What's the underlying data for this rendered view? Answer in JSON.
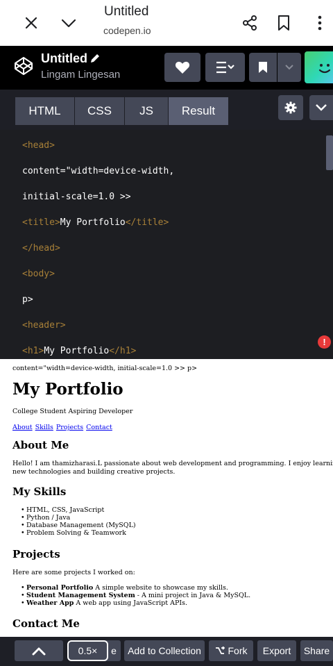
{
  "browser": {
    "title": "Untitled",
    "url": "codepen.io"
  },
  "codepen": {
    "title": "Untitled",
    "author": "Lingam Lingesan"
  },
  "editor": {
    "tabs": [
      {
        "label": "HTML"
      },
      {
        "label": "CSS"
      },
      {
        "label": "JS"
      },
      {
        "label": "Result"
      }
    ],
    "code_lines": [
      {
        "tag": "<head>"
      },
      {
        "text": "content=\"width=device-width,"
      },
      {
        "text": "initial-scale=1.0 >>"
      },
      {
        "open": "<title>",
        "text": "My Portfolio",
        "close": "</title>"
      },
      {
        "tag": "</head>"
      },
      {
        "tag": "<body>"
      },
      {
        "text": "p>"
      },
      {
        "tag": "<header>"
      },
      {
        "open": "<h1>",
        "text": "My Portfolio",
        "close": "</h1>"
      }
    ],
    "error_badge": "!"
  },
  "result": {
    "meta_line": "content=\"width=device-width, initial-scale=1.0 >> p>",
    "heading": "My Portfolio",
    "tagline": "College Student Aspiring Developer",
    "nav_links": [
      "About",
      "Skills",
      "Projects",
      "Contact"
    ],
    "about_heading": "About Me",
    "about_text_1": "Hello! I am thamizharasi.L passionate about web development and programming. I enjoy learning",
    "about_text_2": "new technologies and building creative projects.",
    "skills_heading": "My Skills",
    "skills": [
      "HTML, CSS, JavaScript",
      "Python / Java",
      "Database Management (MySQL)",
      "Problem Solving & Teamwork"
    ],
    "projects_heading": "Projects",
    "projects_intro": "Here are some projects I worked on:",
    "projects": [
      {
        "name": "Personal Portfolio",
        "desc": " A simple website to showcase my skills."
      },
      {
        "name": "Student Management System",
        "desc": " - A mini project in Java & MySQL."
      },
      {
        "name": "Weather App",
        "desc": " A web app using JavaScript APIs."
      }
    ],
    "contact_heading": "Contact Me"
  },
  "toolbar": {
    "zoom": "0.5×",
    "partial_label": "e",
    "add_to_collection": "Add to Collection",
    "fork": "Fork",
    "export": "Export",
    "share": "Share"
  }
}
